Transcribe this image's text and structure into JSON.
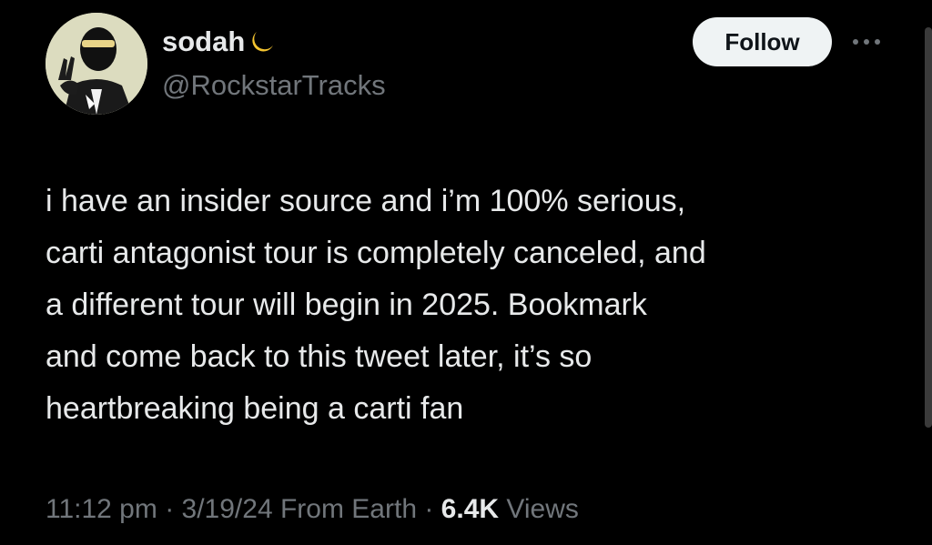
{
  "user": {
    "display_name": "sodah",
    "display_name_emoji": "crescent-moon-icon",
    "handle": "@RockstarTracks",
    "avatar": "masked-figure-peace-sign-avatar"
  },
  "actions": {
    "follow_label": "Follow",
    "more_icon": "more-dots-icon"
  },
  "tweet": {
    "text": "i have an insider source and i’m 100% serious,\ncarti antagonist tour is completely canceled, and\na different tour will begin in 2025. Bookmark\nand come back to this tweet later, it’s so\nheartbreaking being a carti fan"
  },
  "meta": {
    "time": "11:12 pm",
    "separator1": " · ",
    "date": "3/19/24",
    "location": "From Earth",
    "separator2": " · ",
    "views_count": "6.4K",
    "views_label": "Views"
  },
  "colors": {
    "background": "#000000",
    "primary_text": "#e7e9ea",
    "secondary_text": "#71767b",
    "follow_bg": "#eff3f4",
    "moon": "#f4c430"
  }
}
